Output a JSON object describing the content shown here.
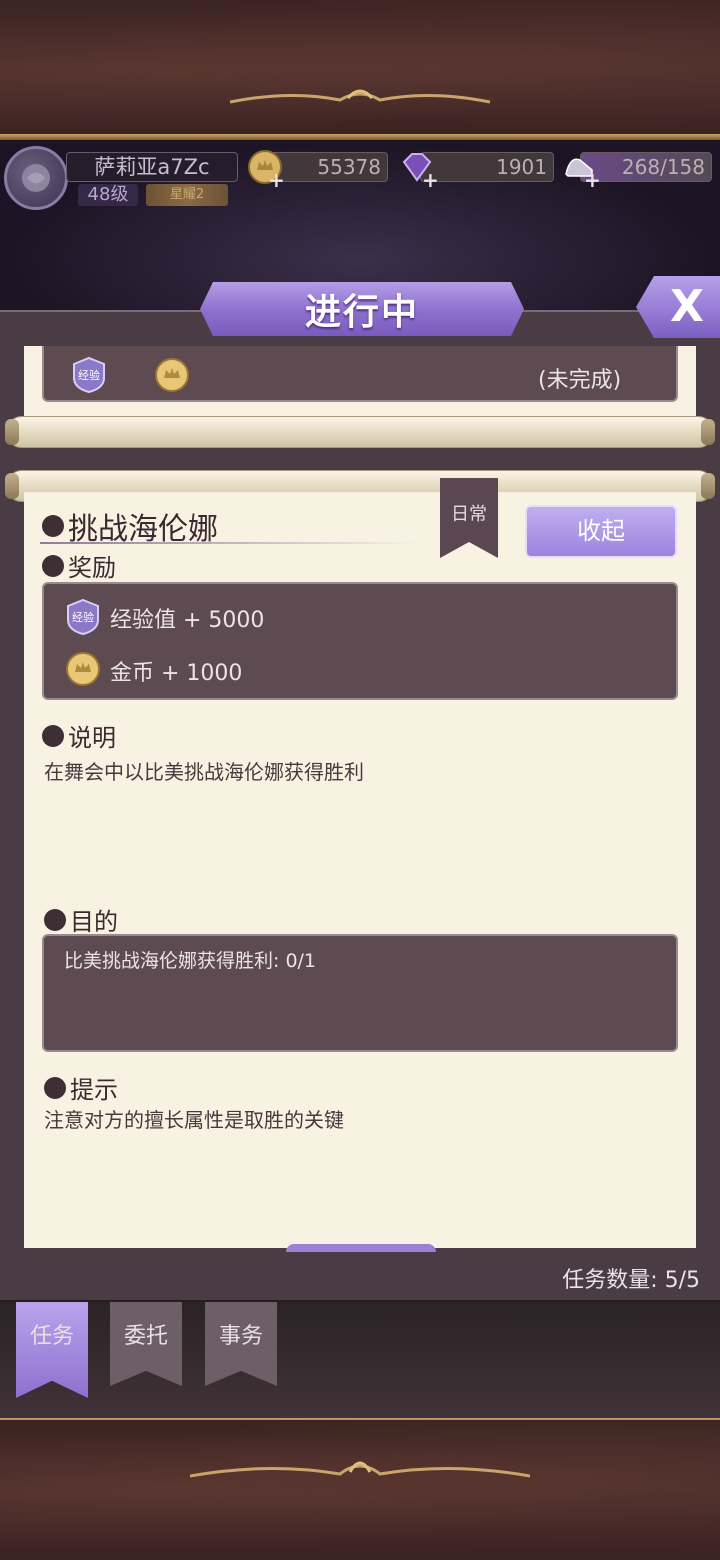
{
  "header": {
    "player_name": "萨莉亚a7Zc",
    "level": "48级",
    "rank": "星耀2",
    "coins": "55378",
    "gems": "1901",
    "stamina": "268/158"
  },
  "window": {
    "title": "进行中",
    "close_label": "X"
  },
  "previous_task": {
    "status": "(未完成)",
    "exp_badge": "经验"
  },
  "task": {
    "name": "挑战海伦娜",
    "category_tag": "日常",
    "collapse_label": "收起",
    "reward_heading": "奖励",
    "rewards": [
      {
        "badge": "经验",
        "label": "经验值 + 5000"
      },
      {
        "label": "金币 + 1000"
      }
    ],
    "description_heading": "说明",
    "description": "在舞会中以比美挑战海伦娜获得胜利",
    "objective_heading": "目的",
    "objective": "比美挑战海伦娜获得胜利: 0/1",
    "hint_heading": "提示",
    "hint": "注意对方的擅长属性是取胜的关键"
  },
  "task_count": "任务数量:  5/5",
  "tabs": [
    {
      "label": "任务",
      "active": true
    },
    {
      "label": "委托",
      "active": false
    },
    {
      "label": "事务",
      "active": false
    }
  ],
  "colors": {
    "accent_purple": "#9d83de",
    "panel_dark": "#5e4b52",
    "paper": "#f8f2e3"
  }
}
